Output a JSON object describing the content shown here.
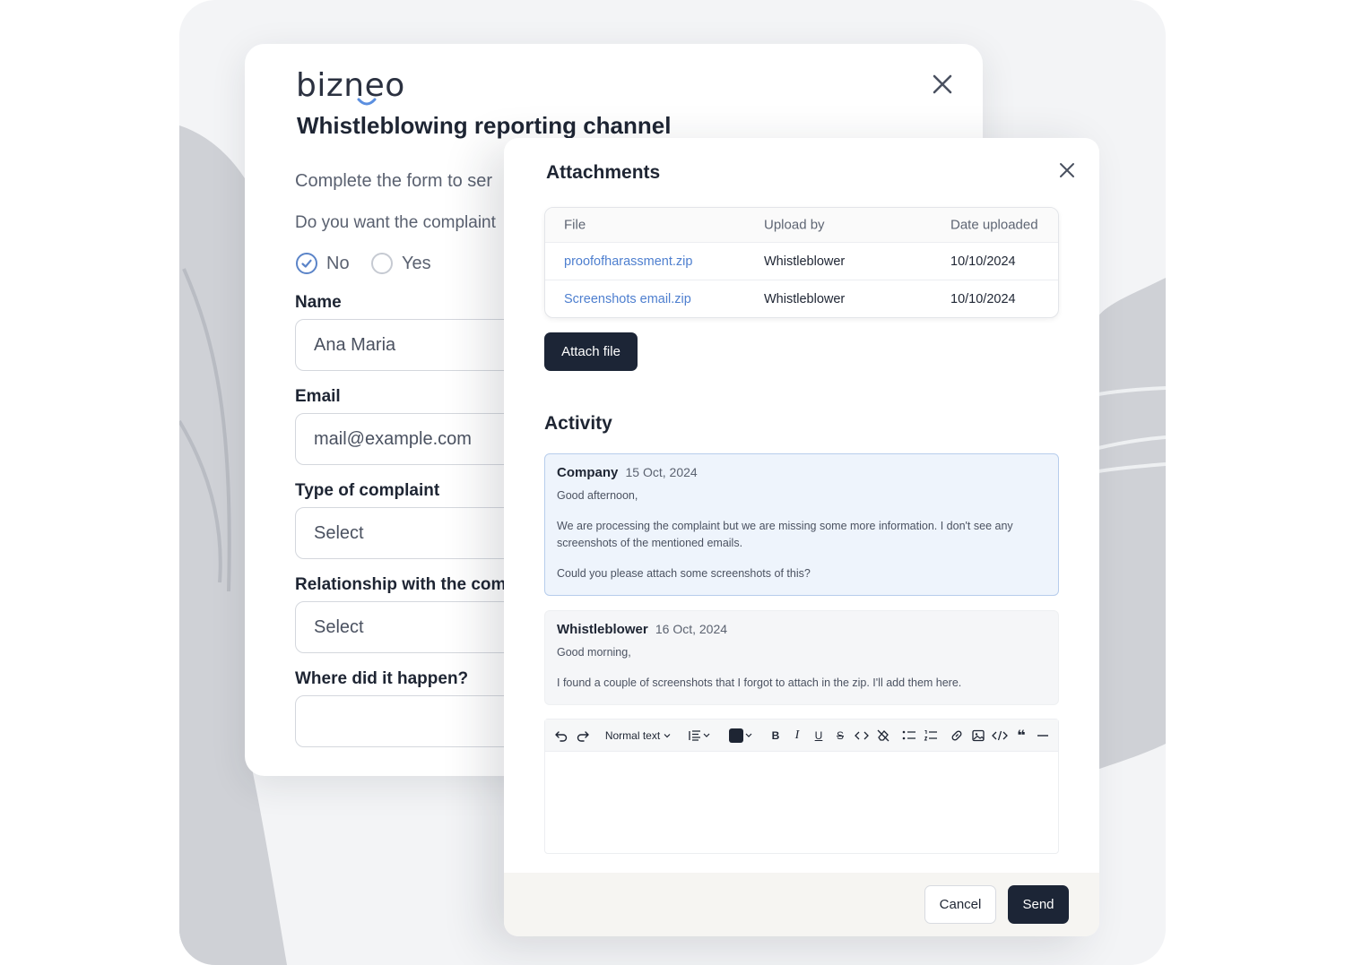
{
  "form": {
    "brand": "bizneo",
    "title": "Whistleblowing reporting channel",
    "intro": "Complete the form to ser",
    "question": "Do you want the complaint",
    "radio_no": "No",
    "radio_yes": "Yes",
    "radio_selected": "No",
    "name_label": "Name",
    "name_value": "Ana Maria",
    "email_label": "Email",
    "email_value": "mail@example.com",
    "type_label": "Type of complaint",
    "type_value": "Select",
    "relationship_label": "Relationship with the comp",
    "relationship_value": "Select",
    "where_label": "Where did it happen?",
    "where_value": ""
  },
  "modal": {
    "title": "Attachments",
    "table": {
      "headers": [
        "File",
        "Upload by",
        "Date uploaded"
      ],
      "rows": [
        [
          "proofofharassment.zip",
          "Whistleblower",
          "10/10/2024"
        ],
        [
          "Screenshots email.zip",
          "Whistleblower",
          "10/10/2024"
        ]
      ]
    },
    "attach_button": "Attach file",
    "activity_title": "Activity",
    "messages": [
      {
        "author": "Company",
        "date": "15 Oct, 2024",
        "paragraphs": [
          "Good afternoon,",
          "We are processing the complaint but we are missing some more information. I don't see any screenshots of the mentioned emails.",
          "Could you please attach some screenshots of this?"
        ]
      },
      {
        "author": "Whistleblower",
        "date": "16 Oct, 2024",
        "paragraphs": [
          "Good morning,",
          "I found a couple of screenshots that I forgot to attach in the zip. I'll add them here."
        ]
      }
    ],
    "editor": {
      "text_style": "Normal text",
      "content": ""
    },
    "cancel_button": "Cancel",
    "send_button": "Send"
  },
  "colors": {
    "primary_dark": "#1c2536",
    "link": "#4e7fcf",
    "company_message_bg": "#eef4fc",
    "company_message_border": "#b7cdec",
    "radio_checked": "#5b84c8"
  }
}
